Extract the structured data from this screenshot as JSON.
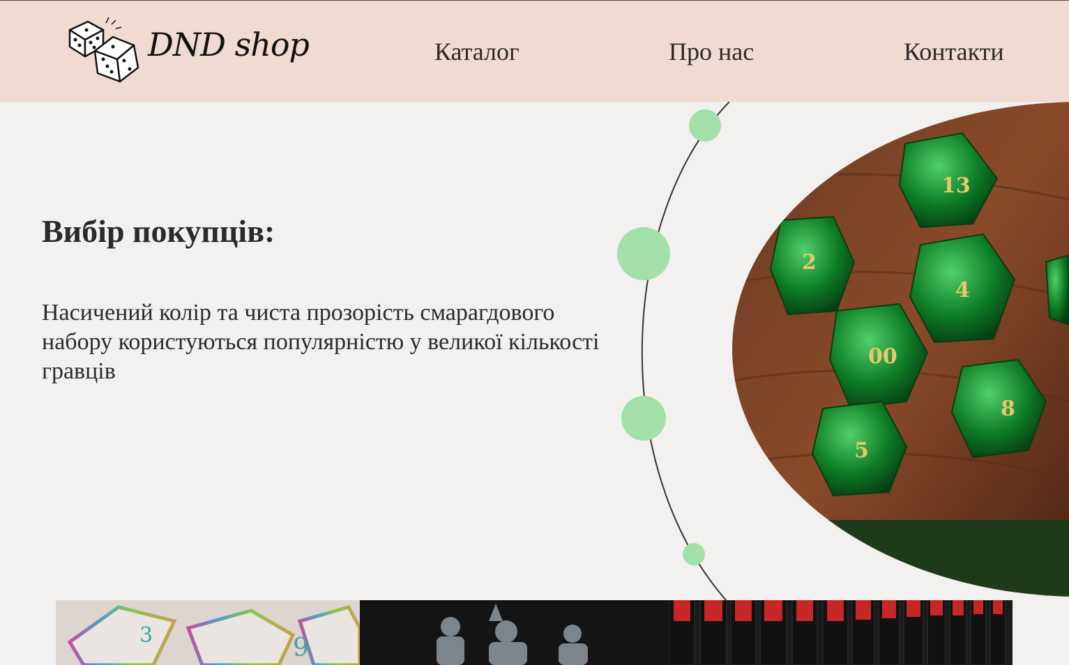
{
  "header": {
    "logo_text": "DND shop",
    "nav": [
      {
        "label": "Каталог"
      },
      {
        "label": "Про нас"
      },
      {
        "label": "Контакти"
      }
    ]
  },
  "hero": {
    "title": "Вибір покупців:",
    "description": "Насичений колір та чиста прозорість смарагдового набору користуються популярністю у великої кількості гравців",
    "image_icon": "green-dice-photo"
  },
  "gallery": [
    {
      "icon": "rainbow-metal-dice-photo"
    },
    {
      "icon": "miniature-figures-photo"
    },
    {
      "icon": "rulebooks-shelf-photo"
    }
  ],
  "colors": {
    "header_bg": "#f0dbd2",
    "page_bg": "#f2f1ef",
    "accent_green": "#a3dfa9"
  }
}
